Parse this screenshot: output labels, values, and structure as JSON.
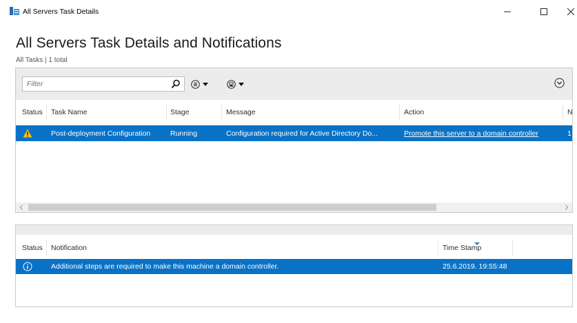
{
  "window": {
    "title": "All Servers Task Details",
    "icon": "server-manager-icon"
  },
  "page": {
    "title": "All Servers Task Details and Notifications",
    "subtitle": "All Tasks | 1 total"
  },
  "toolbar": {
    "filter_placeholder": "Filter",
    "search_icon": "search-icon",
    "list_icon": "list-options-icon",
    "save_icon": "save-query-icon",
    "expand_icon": "expand-chevron-icon"
  },
  "tasks_grid": {
    "columns": [
      "Status",
      "Task Name",
      "Stage",
      "Message",
      "Action",
      "N"
    ],
    "rows": [
      {
        "status_icon": "warning-icon",
        "task_name": "Post-deployment Configuration",
        "stage": "Running",
        "message": "Configuration required for Active Directory Do...",
        "action": "Promote this server to a domain controller",
        "n": "1"
      }
    ]
  },
  "notifications_grid": {
    "columns": [
      "Status",
      "Notification",
      "Time Stamp"
    ],
    "rows": [
      {
        "status_icon": "info-icon",
        "notification": "Additional steps are required to make this machine a domain controller.",
        "time_stamp": "25.6.2019. 19:55:48"
      }
    ]
  },
  "colors": {
    "selection": "#0a72c6",
    "toolbar_bg": "#ececec",
    "warning": "#f5c518"
  }
}
